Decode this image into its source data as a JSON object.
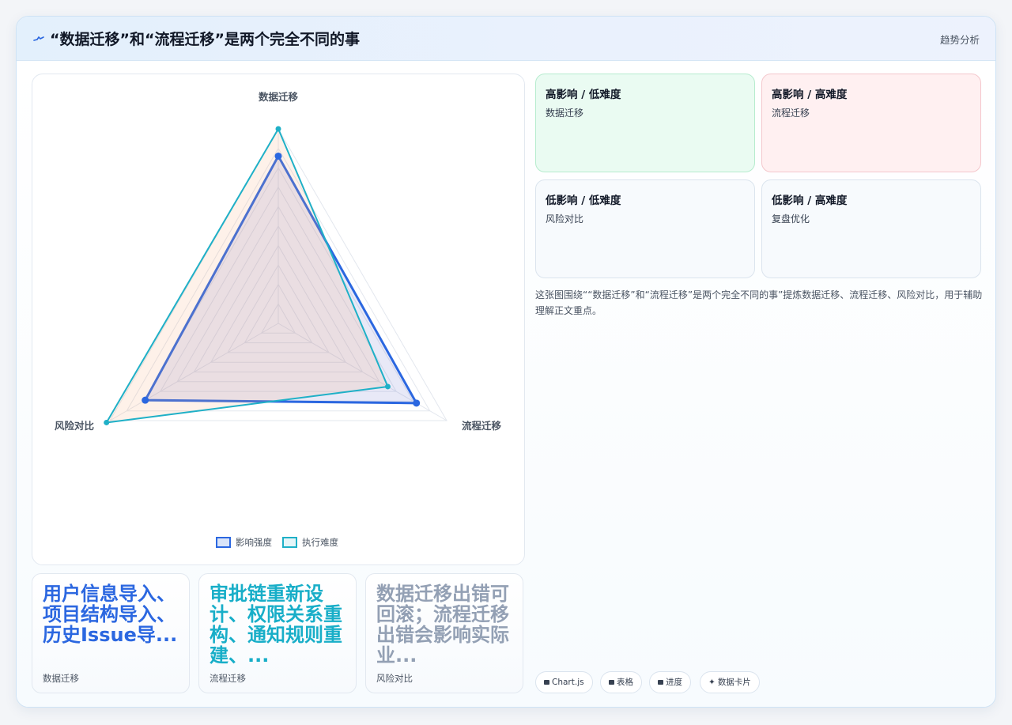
{
  "header": {
    "title": "“数据迁移”和“流程迁移”是两个完全不同的事",
    "link": "趋势分析"
  },
  "chart_data": {
    "type": "radar",
    "axes": [
      "数据迁移",
      "流程迁移",
      "风险对比"
    ],
    "series": [
      {
        "name": "影响强度",
        "values": [
          0.86,
          0.82,
          0.79
        ],
        "color": "#2b67e0"
      },
      {
        "name": "执行难度",
        "values": [
          1.0,
          0.65,
          1.02
        ],
        "color": "#1fb0c7"
      }
    ],
    "range": [
      0,
      1
    ],
    "grid_rings": 10
  },
  "cards": [
    {
      "text": "用户信息导入、项目结构导入、历史Issue导...",
      "label": "数据迁移",
      "color": "#2b67e0"
    },
    {
      "text": "审批链重新设计、权限关系重构、通知规则重建、...",
      "label": "流程迁移",
      "color": "#18aec8"
    },
    {
      "text": "数据迁移出错可回滚；流程迁移出错会影响实际业...",
      "label": "风险对比",
      "color": "#93a0b4"
    }
  ],
  "quadrants": [
    {
      "title": "高影响 / 低难度",
      "item": "数据迁移",
      "bg": "#eafbf2",
      "border": "#b6ecce"
    },
    {
      "title": "高影响 / 高难度",
      "item": "流程迁移",
      "bg": "#fff0f1",
      "border": "#f4c7cc"
    },
    {
      "title": "低影响 / 低难度",
      "item": "风险对比",
      "bg": "#f7fafd",
      "border": "#dbe4ee"
    },
    {
      "title": "低影响 / 高难度",
      "item": "复盘优化",
      "bg": "#f7fafd",
      "border": "#dbe4ee"
    }
  ],
  "description": "这张图围绕““数据迁移”和“流程迁移”是两个完全不同的事”提炼数据迁移、流程迁移、风险对比，用于辅助理解正文重点。",
  "chips": [
    {
      "label": "Chart.js",
      "icon": "chart-icon"
    },
    {
      "label": "表格",
      "icon": "table-icon"
    },
    {
      "label": "进度",
      "icon": "progress-icon"
    },
    {
      "label": "数据卡片",
      "icon": "sparkle-icon"
    }
  ]
}
